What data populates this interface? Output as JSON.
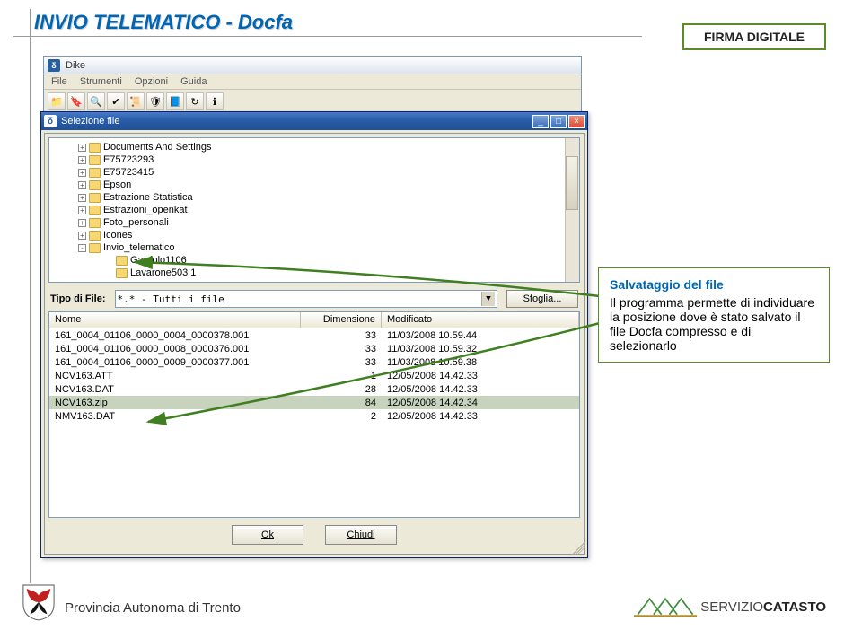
{
  "slide": {
    "title": "INVIO TELEMATICO - Docfa",
    "badge": "FIRMA DIGITALE"
  },
  "dike": {
    "title": "Dike",
    "menu": [
      "File",
      "Strumenti",
      "Opzioni",
      "Guida"
    ],
    "toolbar_icons": [
      "folder-icon",
      "seal-icon",
      "magnify-icon",
      "check-icon",
      "stamp-icon",
      "sealalt-icon",
      "book-icon",
      "refresh-icon",
      "info-icon"
    ]
  },
  "selwin": {
    "title": "Selezione file",
    "tree": [
      {
        "level": 1,
        "exp": "+",
        "label": "Documents And Settings"
      },
      {
        "level": 1,
        "exp": "+",
        "label": "E75723293"
      },
      {
        "level": 1,
        "exp": "+",
        "label": "E75723415"
      },
      {
        "level": 1,
        "exp": "+",
        "label": "Epson"
      },
      {
        "level": 1,
        "exp": "+",
        "label": "Estrazione Statistica"
      },
      {
        "level": 1,
        "exp": "+",
        "label": "Estrazioni_openkat"
      },
      {
        "level": 1,
        "exp": "+",
        "label": "Foto_personali"
      },
      {
        "level": 1,
        "exp": "+",
        "label": "Icones"
      },
      {
        "level": 1,
        "exp": "-",
        "label": "Invio_telematico"
      },
      {
        "level": 2,
        "exp": "",
        "label": "Gardolo1106"
      },
      {
        "level": 2,
        "exp": "",
        "label": "Lavarone503 1"
      }
    ],
    "filetype_label": "Tipo di File:",
    "filetype_value": "*.*  - Tutti i file",
    "sfoglia": "Sfoglia...",
    "cols": {
      "name": "Nome",
      "dim": "Dimensione",
      "mod": "Modificato"
    },
    "files": [
      {
        "n": "161_0004_01106_0000_0004_0000378.001",
        "d": "33",
        "m": "11/03/2008 10.59.44",
        "sel": false
      },
      {
        "n": "161_0004_01106_0000_0008_0000376.001",
        "d": "33",
        "m": "11/03/2008 10.59.32",
        "sel": false
      },
      {
        "n": "161_0004_01106_0000_0009_0000377.001",
        "d": "33",
        "m": "11/03/2008 10.59.38",
        "sel": false
      },
      {
        "n": "NCV163.ATT",
        "d": "1",
        "m": "12/05/2008 14.42.33",
        "sel": false
      },
      {
        "n": "NCV163.DAT",
        "d": "28",
        "m": "12/05/2008 14.42.33",
        "sel": false
      },
      {
        "n": "NCV163.zip",
        "d": "84",
        "m": "12/05/2008 14.42.34",
        "sel": true
      },
      {
        "n": "NMV163.DAT",
        "d": "2",
        "m": "12/05/2008 14.42.33",
        "sel": false
      }
    ],
    "ok": "Ok",
    "close": "Chiudi"
  },
  "callout": {
    "title": "Salvataggio del file",
    "body": "Il programma permette di individuare la posizione dove è stato salvato il file Docfa compresso e di selezionarlo"
  },
  "footer": {
    "text": "Provincia Autonoma di Trento",
    "logo": {
      "brand": "SERVIZIO",
      "brand2": "CATASTO"
    }
  }
}
